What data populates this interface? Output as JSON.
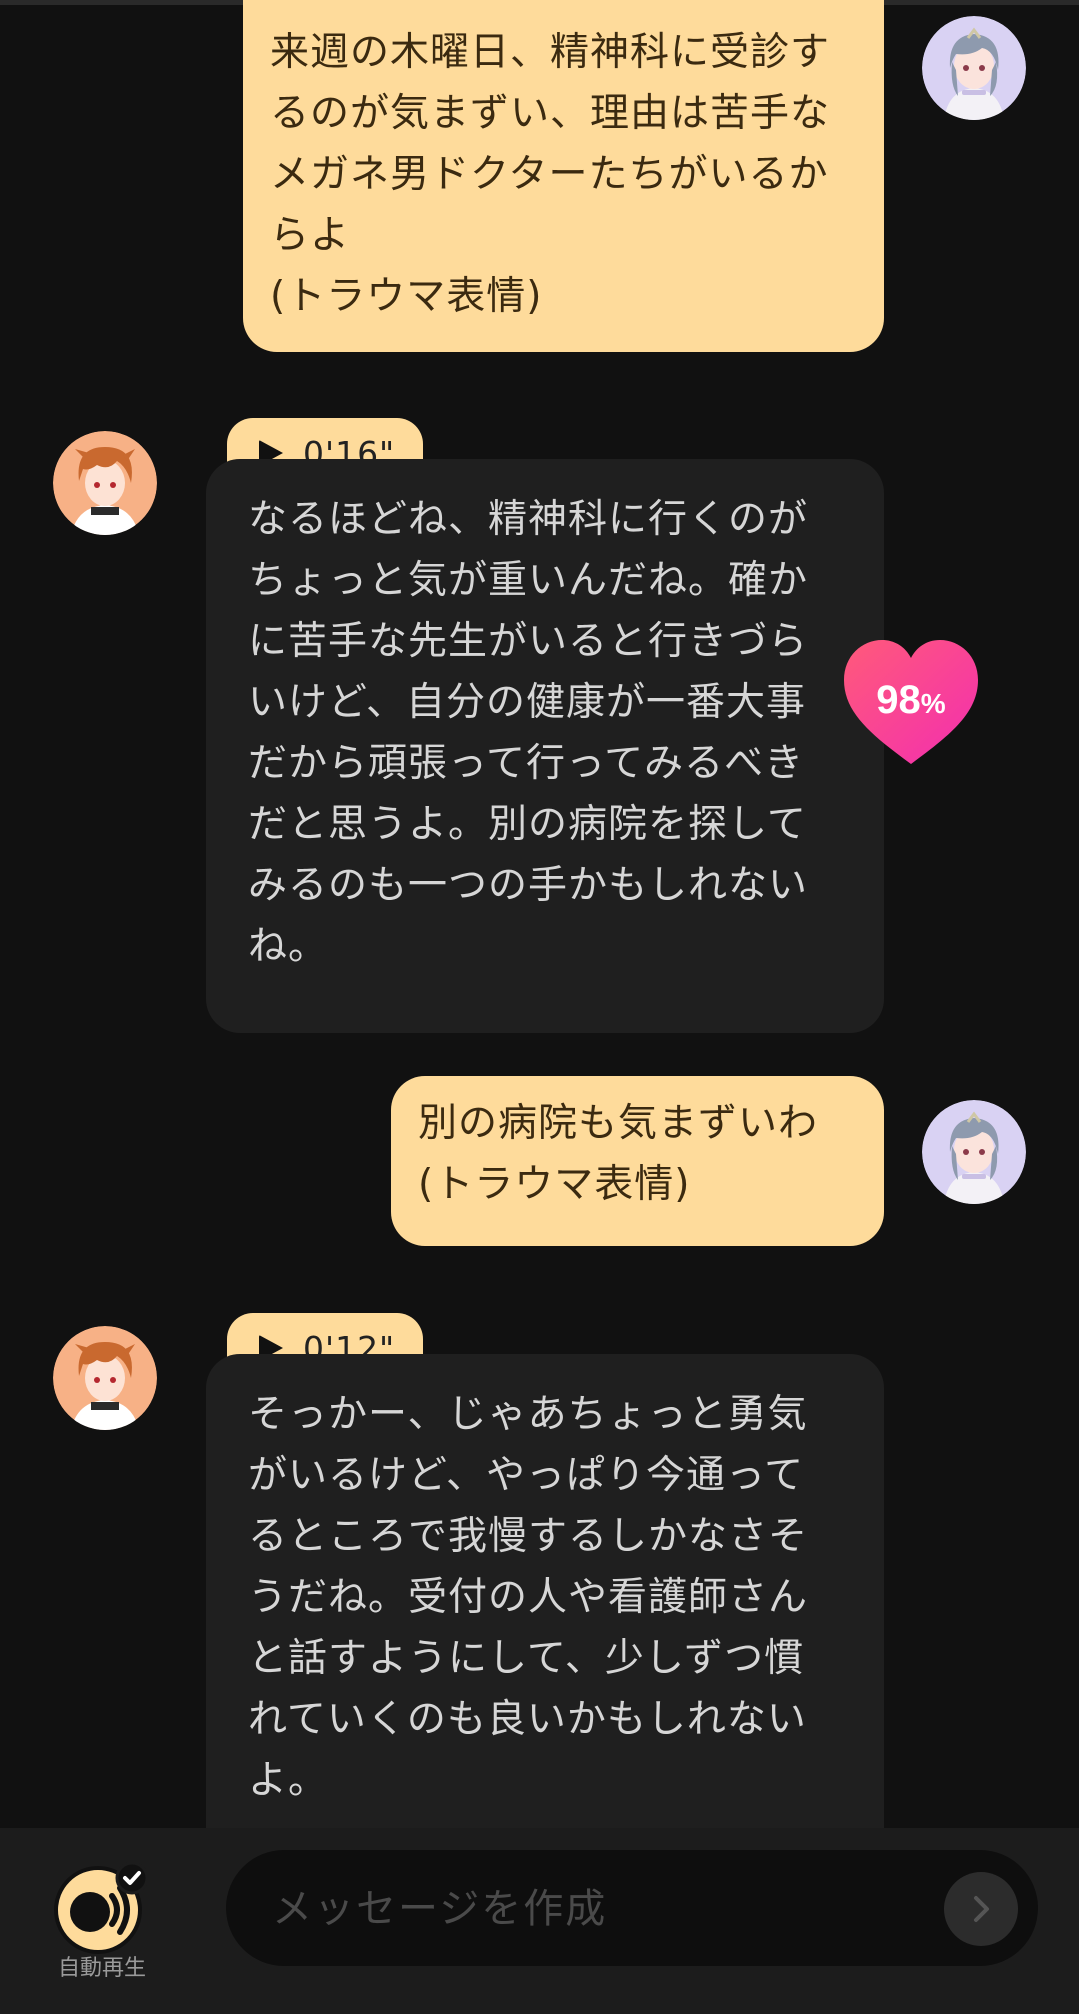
{
  "messages": [
    {
      "sender": "user",
      "text": "来週の木曜日、精神科に受診するのが気まずい、理由は苦手なメガネ男ドクターたちがいるからよ\n(トラウマ表情)"
    },
    {
      "sender": "bot",
      "voice_duration": "0'16\"",
      "text": "なるほどね、精神科に行くのがちょっと気が重いんだね。確かに苦手な先生がいると行きづらいけど、自分の健康が一番大事だから頑張って行ってみるべきだと思うよ。別の病院を探してみるのも一つの手かもしれないね。",
      "affinity_value": "98",
      "affinity_unit": "%"
    },
    {
      "sender": "user",
      "text": "別の病院も気まずいわ\n(トラウマ表情)"
    },
    {
      "sender": "bot",
      "voice_duration": "0'12\"",
      "text": "そっかー、じゃあちょっと勇気がいるけど、やっぱり今通ってるところで我慢するしかなさそうだね。受付の人や看護師さんと話すようにして、少しずつ慣れていくのも良いかもしれないよ。"
    }
  ],
  "bottom_bar": {
    "autoplay_label": "自動再生",
    "input_placeholder": "メッセージを作成"
  },
  "colors": {
    "background": "#111111",
    "user_bubble": "#fedb9b",
    "bot_bubble": "#1f1f1f",
    "heart_gradient_start": "#ff4f8b",
    "heart_gradient_end": "#f72fa5"
  },
  "icons": {
    "play": "play-icon",
    "heart": "heart-icon",
    "autoplay": "autoplay-speaker-icon",
    "send": "chevron-right-icon"
  }
}
